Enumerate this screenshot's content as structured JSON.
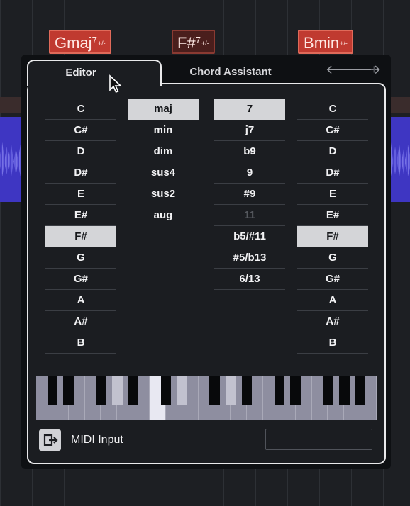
{
  "timeline": {
    "chords": [
      {
        "root": "G",
        "quality": "maj",
        "ext": "7",
        "tag": "+/-"
      },
      {
        "root": "F#",
        "quality": "",
        "ext": "7",
        "tag": "+/-"
      },
      {
        "root": "B",
        "quality": "min",
        "ext": "",
        "tag": "+/-"
      }
    ]
  },
  "tabs": {
    "editor": "Editor",
    "chord_assistant": "Chord Assistant",
    "back_arrow": "🡐",
    "forward_arrow": "🡒",
    "add": "+"
  },
  "root_column": {
    "items": [
      "C",
      "C#",
      "D",
      "D#",
      "E",
      "E#",
      "F#",
      "G",
      "G#",
      "A",
      "A#",
      "B"
    ],
    "selected": "F#"
  },
  "type_column": {
    "items": [
      "maj",
      "min",
      "dim",
      "sus4",
      "sus2",
      "aug"
    ],
    "selected": "maj"
  },
  "tension_column": {
    "items": [
      "7",
      "j7",
      "b9",
      "9",
      "#9",
      "11",
      "b5/#11",
      "#5/b13",
      "6/13"
    ],
    "selected": "7",
    "disabled": [
      "11"
    ]
  },
  "bass_column": {
    "items": [
      "C",
      "C#",
      "D",
      "D#",
      "E",
      "E#",
      "F#",
      "G",
      "G#",
      "A",
      "A#",
      "B"
    ],
    "selected": "F#"
  },
  "keyboard": {
    "highlighted_white_keys": [
      7
    ],
    "highlighted_black_keys": [
      3,
      6,
      8
    ]
  },
  "footer": {
    "midi_input_label": "MIDI Input",
    "midi_icon": "midi-input-icon",
    "display_value": ""
  },
  "colors": {
    "chord_chip": "#c03a30",
    "audio_region": "#3e36c2",
    "selection": "#d4d5d8"
  }
}
